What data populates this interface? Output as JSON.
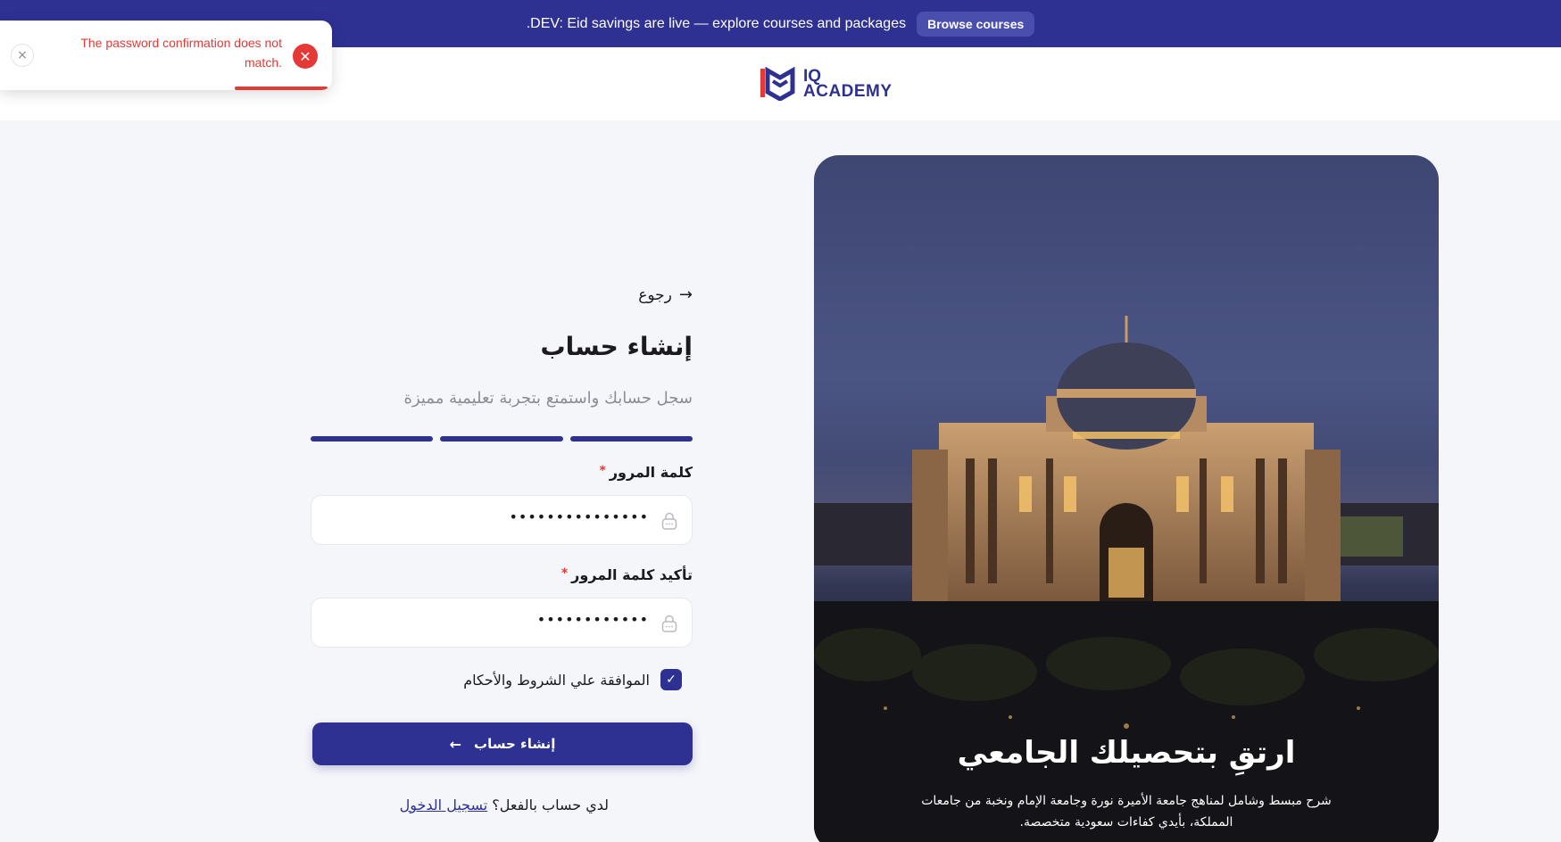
{
  "announcement": {
    "button_label": "Browse courses",
    "message": ".DEV: Eid savings are live — explore courses and packages"
  },
  "header": {
    "logo_line1": "IQ",
    "logo_line2": "ACADEMY"
  },
  "toast": {
    "message": "The password confirmation does not match.",
    "close_glyph": "×",
    "error_glyph": "✕"
  },
  "form": {
    "back_label": "رجوع",
    "title": "إنشاء حساب",
    "subtitle": "سجل حسابك واستمتع بتجربة تعليمية مميزة",
    "password_label": "كلمة المرور",
    "password_value": "•••••••••••••••",
    "confirm_label": "تأكيد كلمة المرور",
    "confirm_value": "••••••••••••",
    "required_marker": "*",
    "terms_label": "الموافقة علي الشروط والأحكام",
    "submit_label": "إنشاء حساب",
    "login_prompt": "لدي حساب بالفعل؟",
    "login_link": "تسجيل الدخول"
  },
  "hero": {
    "title": "ارتقِ بتحصيلك الجامعي",
    "text": "شرح مبسط وشامل لمناهج جامعة الأميرة نورة وجامعة الإمام ونخبة من جامعات المملكة، بأيدي كفاءات سعودية متخصصة."
  },
  "colors": {
    "brand": "#2e3192",
    "error": "#e53935"
  }
}
